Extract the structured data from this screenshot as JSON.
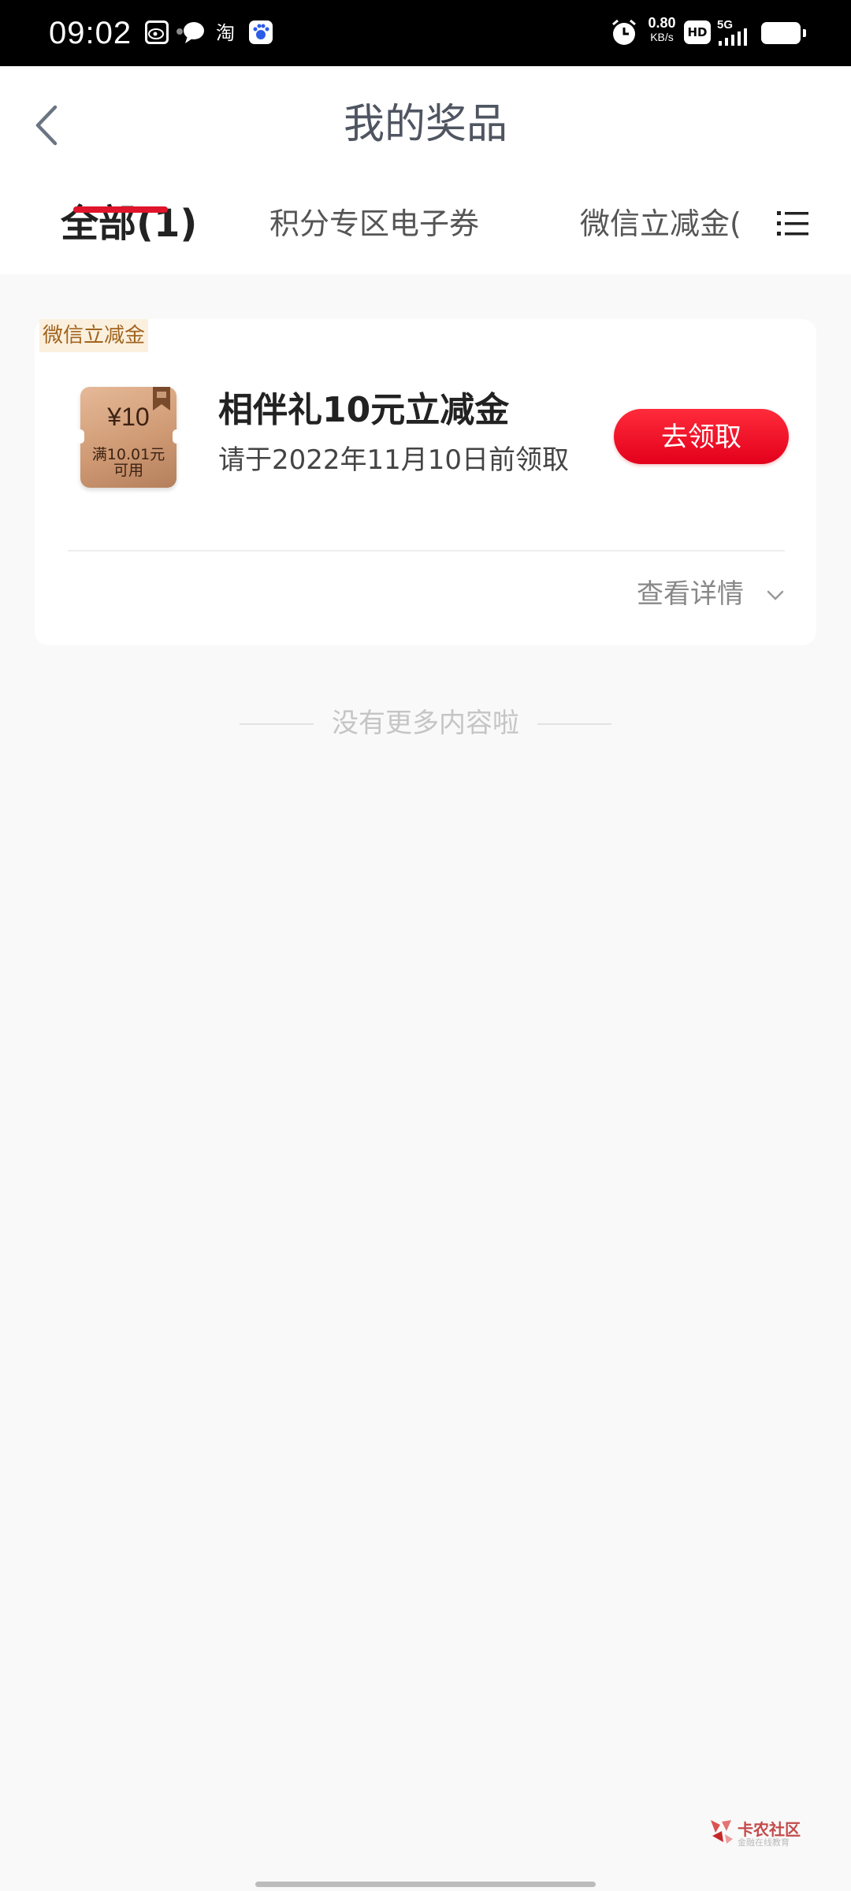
{
  "status_bar": {
    "time": "09:02",
    "app_icons": [
      "weibo-icon",
      "message-icon",
      "taobao-icon",
      "baidu-icon"
    ],
    "taobao_label": "淘",
    "net_speed": "0.80",
    "net_speed_unit": "KB/s",
    "hd_label": "HD",
    "network": "5G",
    "system_icons": [
      "alarm-icon",
      "hd-icon",
      "signal-icon",
      "battery-icon"
    ]
  },
  "header": {
    "title": "我的奖品"
  },
  "tabs": [
    {
      "label": "全部(1)",
      "active": true
    },
    {
      "label": "积分专区电子券",
      "active": false
    },
    {
      "label": "微信立减金(",
      "active": false
    }
  ],
  "prize_card": {
    "tag": "微信立减金",
    "coupon_amount": "¥10",
    "coupon_condition_line1": "满10.01元",
    "coupon_condition_line2": "可用",
    "name": "相伴礼10元立减金",
    "deadline": "请于2022年11月10日前领取",
    "claim_label": "去领取",
    "details_label": "查看详情"
  },
  "no_more_text": "没有更多内容啦",
  "watermark": {
    "title": "卡农社区",
    "subtitle": "金融在线教育"
  },
  "colors": {
    "accent": "#e0142b",
    "tag_bg": "#fbf0de",
    "tag_text": "#a1641f",
    "coupon": "#cf9a74"
  }
}
